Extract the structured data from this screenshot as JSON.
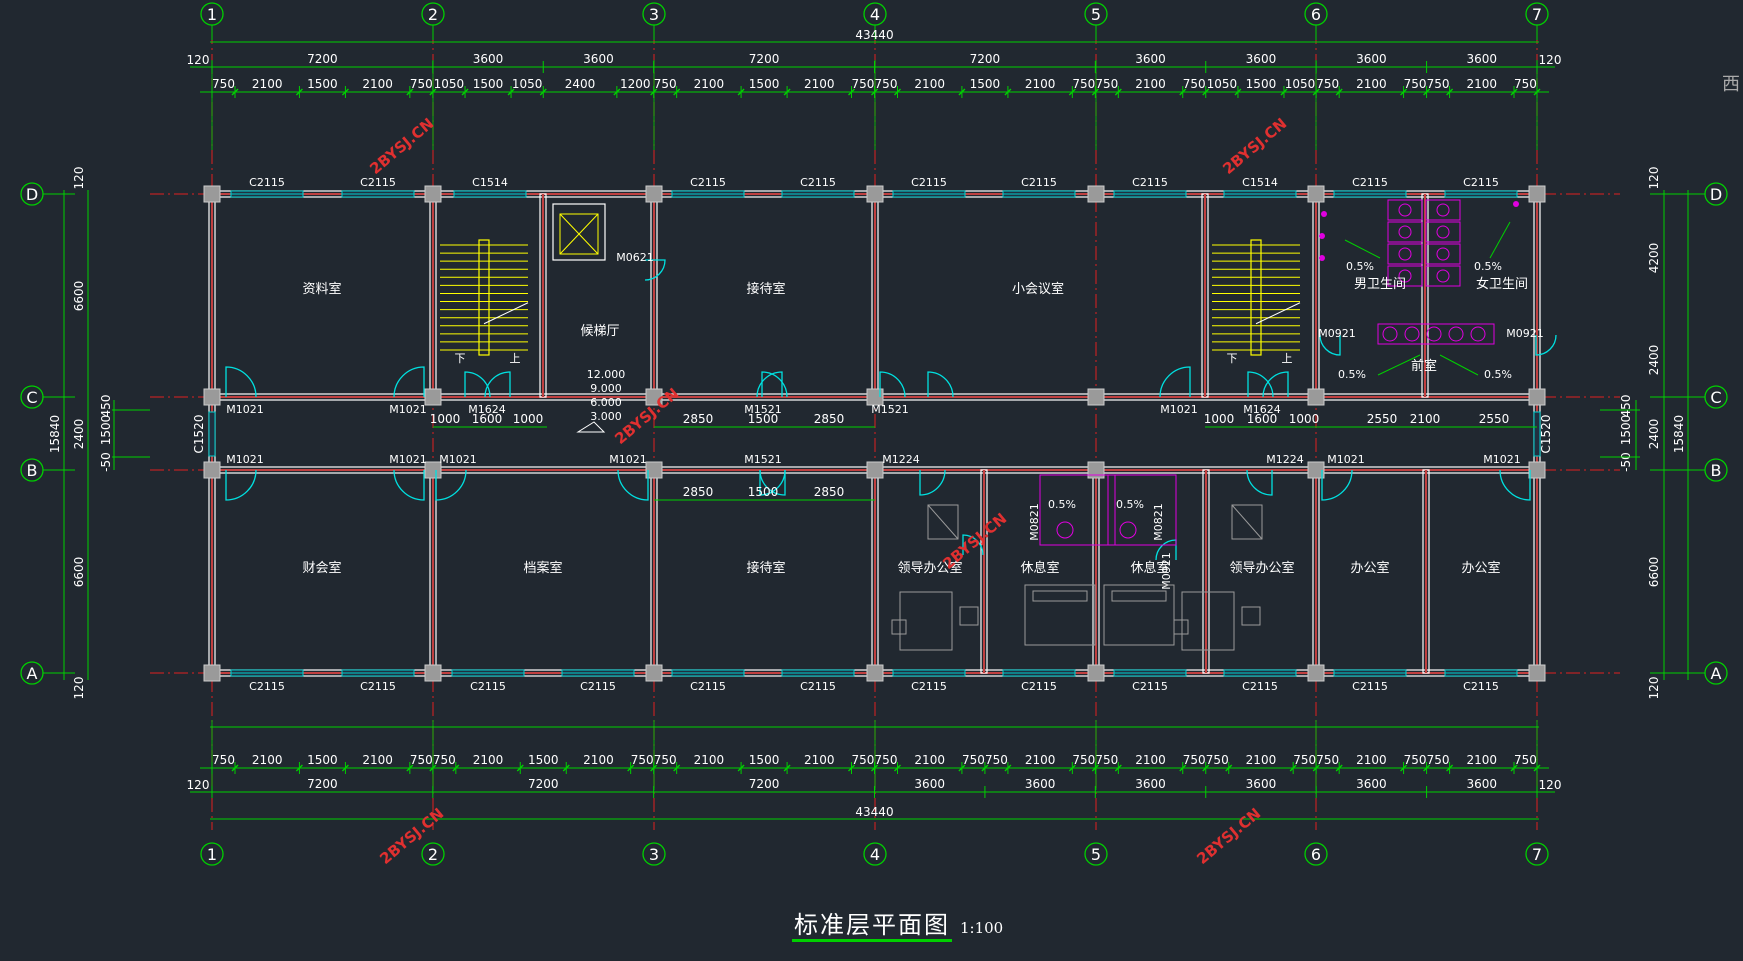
{
  "colors": {
    "bg": "#212830",
    "dim": "#00d000",
    "axis": "#e02020",
    "wall": "#ffffff",
    "door": "#00e0e0",
    "window": "#00d0d0",
    "stair": "#ffff00",
    "fixture": "#e000e0",
    "furniture": "#9a9a9a",
    "watermark": "#e03030"
  },
  "title": "标准层平面图",
  "scale": "1:100",
  "axes_x": [
    "1",
    "2",
    "3",
    "4",
    "5",
    "6",
    "7"
  ],
  "axes_y": [
    "D",
    "C",
    "B",
    "A"
  ],
  "total_width": "43440",
  "top_dims": {
    "outer": [
      "120",
      "7200",
      "3600",
      "3600",
      "7200",
      "7200",
      "3600",
      "3600",
      "3600",
      "3600",
      "120"
    ],
    "inner": [
      "750",
      "2100",
      "1500",
      "2100",
      "750",
      "1050",
      "1500",
      "1050",
      "2400",
      "1200",
      "750",
      "2100",
      "1500",
      "2100",
      "750",
      "750",
      "2100",
      "1500",
      "2100",
      "750",
      "750",
      "2100",
      "750",
      "1050",
      "1500",
      "1050",
      "750",
      "2100",
      "750",
      "750",
      "2100",
      "750"
    ]
  },
  "bottom_dims": {
    "outer": [
      "120",
      "7200",
      "7200",
      "7200",
      "3600",
      "3600",
      "3600",
      "3600",
      "3600",
      "3600",
      "120"
    ],
    "inner": [
      "750",
      "2100",
      "1500",
      "2100",
      "750",
      "750",
      "2100",
      "1500",
      "2100",
      "750",
      "750",
      "2100",
      "1500",
      "2100",
      "750",
      "750",
      "2100",
      "750",
      "750",
      "2100",
      "750",
      "750",
      "2100",
      "750",
      "750",
      "2100",
      "750",
      "750",
      "2100",
      "750",
      "750",
      "2100",
      "750"
    ]
  },
  "left_dims": {
    "outer": [
      "120",
      "6600",
      "2400",
      "6600",
      "120"
    ],
    "inner": [
      "450",
      "1500",
      "-50"
    ],
    "total": "15840"
  },
  "right_dims": {
    "outer": [
      "120",
      "4200",
      "2400",
      "2400",
      "6600",
      "120"
    ],
    "inner": [
      "450",
      "1500",
      "-50"
    ],
    "total": "15840"
  },
  "rooms": [
    "资料室",
    "候梯厅",
    "接待室",
    "小会议室",
    "男卫生间",
    "女卫生间",
    "前室",
    "财会室",
    "档案室",
    "接待室",
    "领导办公室",
    "休息室",
    "休息室",
    "领导办公室",
    "办公室",
    "办公室"
  ],
  "windows_top": [
    "C2115",
    "C2115",
    "C1514",
    "C2115",
    "C2115",
    "C2115",
    "C2115",
    "C2115",
    "C1514",
    "C2115",
    "C2115"
  ],
  "windows_bottom": [
    "C2115",
    "C2115",
    "C2115",
    "C2115",
    "C2115",
    "C2115",
    "C2115",
    "C2115",
    "C2115",
    "C2115",
    "C2115",
    "C2115"
  ],
  "doors": [
    "M1021",
    "M1021",
    "M1624",
    "M1521",
    "M1521",
    "M1021",
    "M1624",
    "M0621",
    "M0921",
    "M0921",
    "M1021",
    "M1021",
    "M1021",
    "M1021",
    "M1521",
    "M1224",
    "M1224",
    "M1021",
    "M1021",
    "M0821",
    "M0821",
    "M0921",
    "C1520",
    "C1520"
  ],
  "corridor_dims": [
    "1000",
    "1600",
    "1000",
    "2850",
    "1500",
    "2850",
    "1000",
    "1600",
    "1000",
    "2550",
    "2100",
    "2550",
    "2850",
    "1500",
    "2850"
  ],
  "elevations": [
    "12.000",
    "9.000",
    "6.000",
    "3.000"
  ],
  "slopes": [
    "0.5%",
    "0.5%",
    "0.5%",
    "0.5%",
    "0.5%",
    "0.5%"
  ],
  "stair_labels": [
    "下",
    "上",
    "下",
    "上"
  ],
  "watermark": "2BYSJ.CN",
  "edge_glyph": "西"
}
